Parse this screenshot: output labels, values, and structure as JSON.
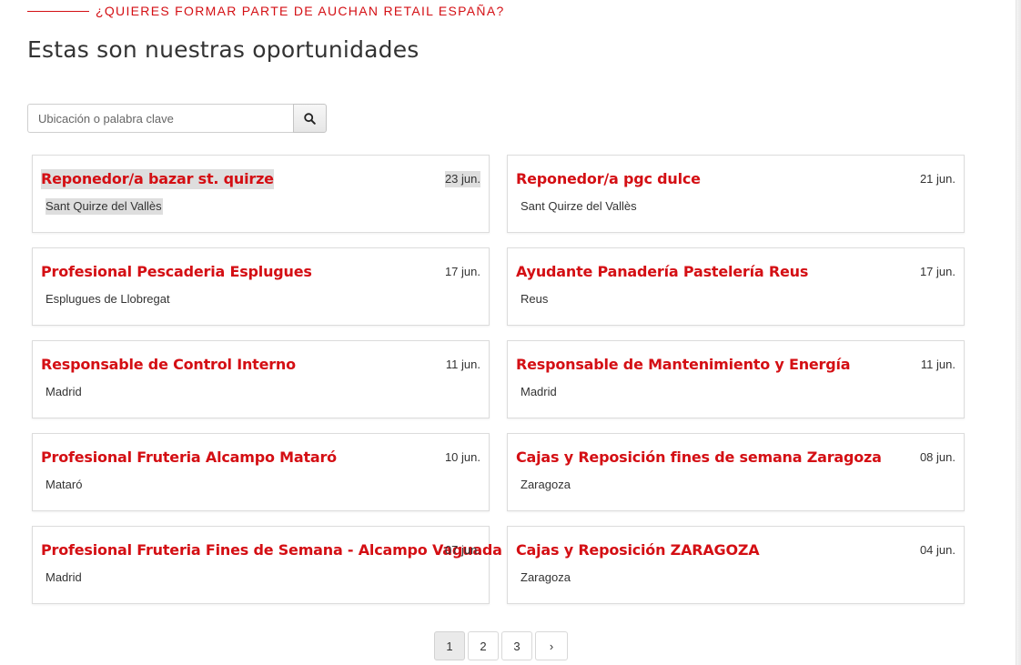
{
  "header": {
    "eyebrow": "¿QUIERES FORMAR PARTE DE AUCHAN RETAIL ESPAÑA?",
    "title": "Estas son nuestras oportunidades"
  },
  "search": {
    "placeholder": "Ubicación o palabra clave",
    "icon": "search-icon"
  },
  "jobs": [
    {
      "title": "Reponedor/a bazar st. quirze",
      "date": "23 jun.",
      "location": "Sant Quirze del Vallès"
    },
    {
      "title": "Reponedor/a pgc dulce",
      "date": "21 jun.",
      "location": "Sant Quirze del Vallès"
    },
    {
      "title": "Profesional Pescaderia Esplugues",
      "date": "17 jun.",
      "location": "Esplugues de Llobregat"
    },
    {
      "title": "Ayudante Panadería Pastelería Reus",
      "date": "17 jun.",
      "location": "Reus"
    },
    {
      "title": "Responsable de Control Interno",
      "date": "11 jun.",
      "location": "Madrid"
    },
    {
      "title": "Responsable de Mantenimiento y Energía",
      "date": "11 jun.",
      "location": "Madrid"
    },
    {
      "title": "Profesional Fruteria Alcampo Mataró",
      "date": "10 jun.",
      "location": "Mataró"
    },
    {
      "title": "Cajas y Reposición fines de semana Zaragoza",
      "date": "08 jun.",
      "location": "Zaragoza"
    },
    {
      "title": "Profesional Fruteria Fines de Semana - Alcampo Vaguada",
      "date": "07 jun.",
      "location": "Madrid"
    },
    {
      "title": "Cajas y Reposición ZARAGOZA",
      "date": "04 jun.",
      "location": "Zaragoza"
    }
  ],
  "pagination": {
    "pages": [
      "1",
      "2",
      "3"
    ],
    "current": "1",
    "next": "›"
  },
  "colors": {
    "accent": "#d40f14",
    "highlight": "#dedede"
  }
}
